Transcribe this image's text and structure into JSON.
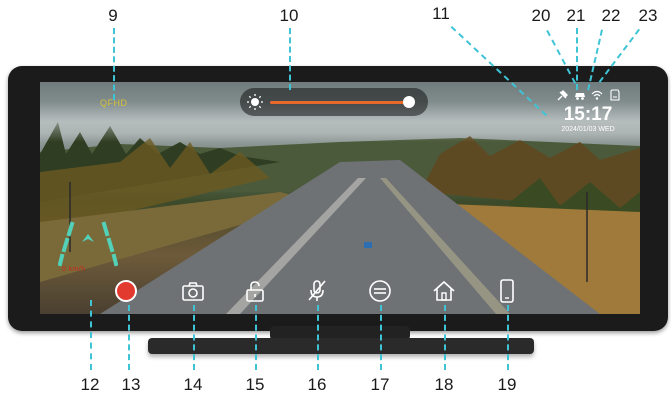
{
  "callouts": {
    "top": [
      "9",
      "10",
      "11",
      "20",
      "21",
      "22",
      "23"
    ],
    "bottom": [
      "12",
      "13",
      "14",
      "15",
      "16",
      "17",
      "18",
      "19"
    ]
  },
  "screen": {
    "resolution": "QFHD",
    "brightness_level": 0.95,
    "clock": "15:17",
    "date": "2024/01/03 WED",
    "speed_text": "0 km/h",
    "status_icons": [
      "satellite-icon",
      "car-icon",
      "wifi-icon",
      "sd-card-icon"
    ],
    "buttons": [
      "record-button",
      "camera-button",
      "lock-button",
      "mute-mic-button",
      "adas-button",
      "home-button",
      "phone-button"
    ]
  },
  "colors": {
    "leader": "#3fc4d6",
    "record": "#e23a2e",
    "slider": "#e9682c",
    "guide_lines": "#53d1b8",
    "resolution": "#d4c23a"
  }
}
